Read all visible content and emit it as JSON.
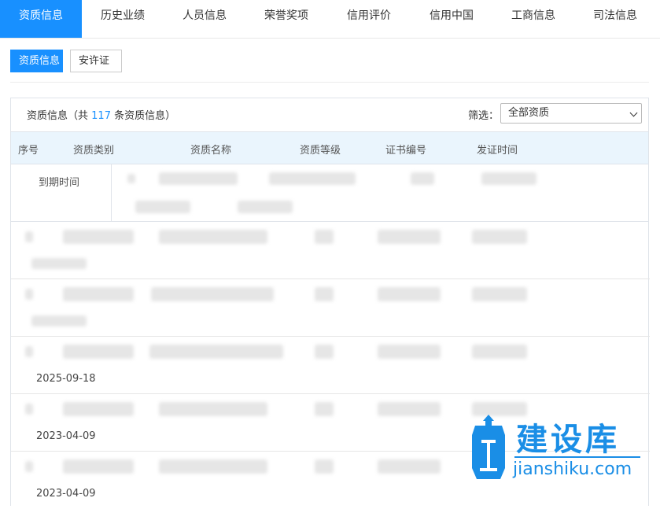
{
  "top_nav": {
    "tabs": [
      "资质信息",
      "历史业绩",
      "人员信息",
      "荣誉奖项",
      "信用评价",
      "信用中国",
      "工商信息",
      "司法信息"
    ],
    "active": "资质信息"
  },
  "sub_tabs": {
    "items": [
      "资质信息",
      "安许证"
    ],
    "active": "资质信息"
  },
  "panel": {
    "title_prefix": "资质信息（共",
    "count": "117",
    "title_suffix": "条资质信息）",
    "filter_label": "筛选：",
    "filter_value": "全部资质"
  },
  "table": {
    "columns": [
      "序号",
      "资质类别",
      "资质名称",
      "资质等级",
      "证书编号",
      "发证时间"
    ],
    "sub_column": "到期时间",
    "visible_dates": [
      "2025-09-18",
      "2023-04-09",
      "2023-04-09"
    ]
  },
  "watermark": {
    "text": "建设库",
    "url": "jianshiku.com",
    "color": "#1a8ee6"
  },
  "colors": {
    "accent": "#1890ff",
    "header_bg": "#eaf5fd"
  }
}
